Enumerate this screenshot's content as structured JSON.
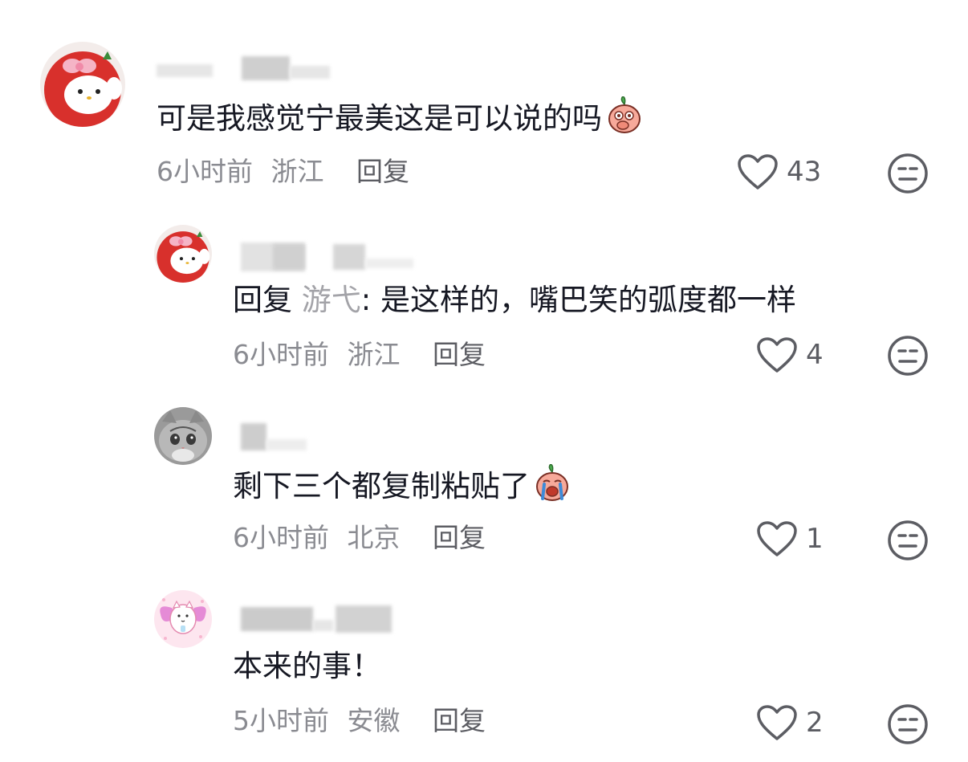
{
  "comments": [
    {
      "text": "可是我感觉宁最美这是可以说的吗",
      "time": "6小时前",
      "location": "浙江",
      "reply_label": "回复",
      "likes": "43",
      "emoji": "peach-shy-emoji"
    },
    {
      "reply_prefix": "回复",
      "reply_target": "游弋",
      "text": ": 是这样的，嘴巴笑的弧度都一样",
      "time": "6小时前",
      "location": "浙江",
      "reply_label": "回复",
      "likes": "4"
    },
    {
      "text": "剩下三个都复制粘贴了",
      "time": "6小时前",
      "location": "北京",
      "reply_label": "回复",
      "likes": "1",
      "emoji": "peach-crying-emoji"
    },
    {
      "text": "本来的事！",
      "time": "5小时前",
      "location": "安徽",
      "reply_label": "回复",
      "likes": "2"
    }
  ],
  "colors": {
    "text_primary": "#161823",
    "text_secondary": "#8a8b91",
    "reply_target": "#a3a3a8",
    "icon": "#5c5d63"
  }
}
